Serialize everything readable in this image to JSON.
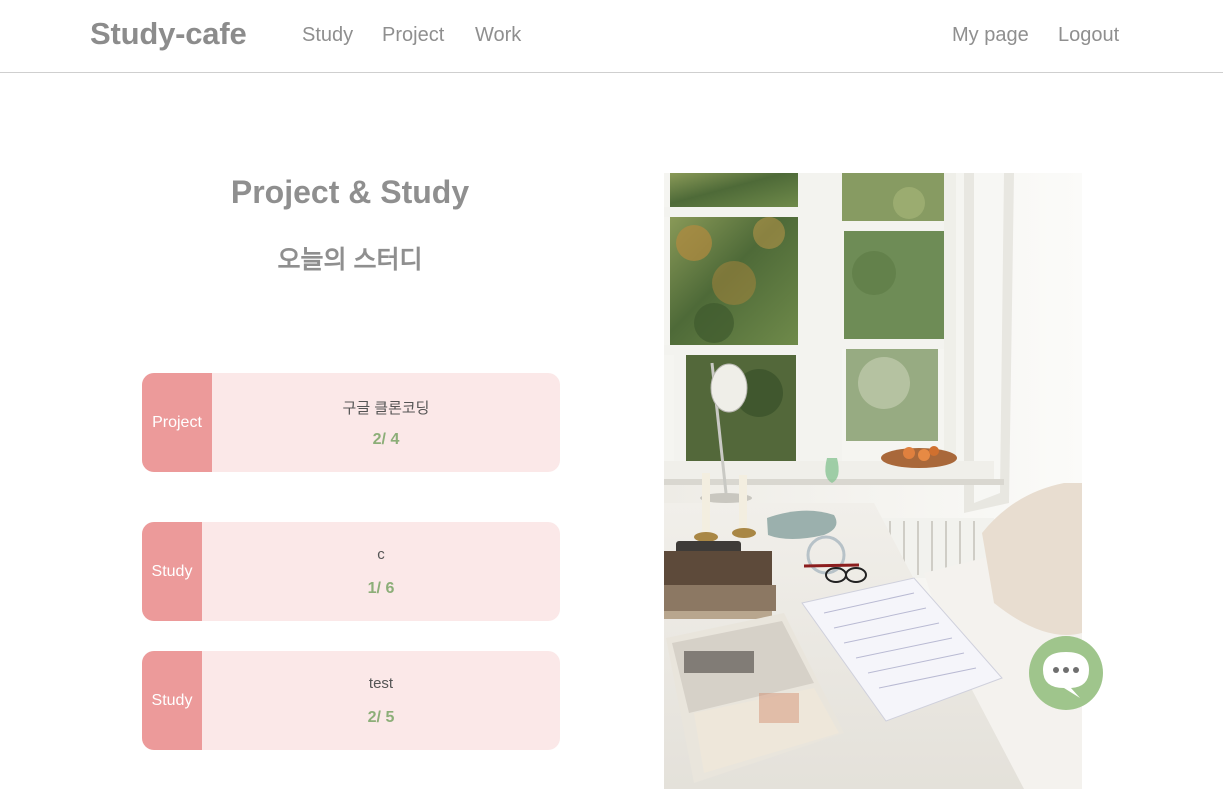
{
  "header": {
    "brand": "Study-cafe",
    "nav": [
      "Study",
      "Project",
      "Work"
    ],
    "user_nav": [
      "My page",
      "Logout"
    ]
  },
  "main": {
    "title": "Project & Study",
    "subtitle": "오늘의 스터디",
    "cards": [
      {
        "tag": "Project",
        "name": "구글 클론코딩",
        "count": "2/ 4"
      },
      {
        "tag": "Study",
        "name": "c",
        "count": "1/ 6"
      },
      {
        "tag": "Study",
        "name": "test",
        "count": "2/ 5"
      }
    ]
  },
  "hero_image": {
    "icon": "study-desk-photo"
  },
  "chat": {
    "icon": "chat-bubble-icon"
  },
  "colors": {
    "tag": "#ec9a9a",
    "card_bg": "#fbe8e8",
    "count": "#8cae78",
    "chat": "#9fc58c",
    "text": "#8f8f8f"
  }
}
